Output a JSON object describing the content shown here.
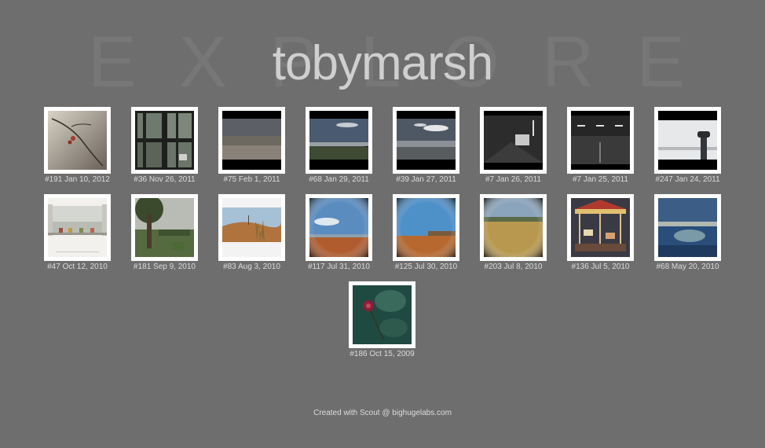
{
  "header": {
    "background_word": [
      "E",
      "X",
      "P",
      "L",
      "O",
      "R",
      "E"
    ],
    "username": "tobymarsh"
  },
  "photos": [
    {
      "caption": "#191 Jan 10, 2012",
      "icon": "bare-branch-berries-photo"
    },
    {
      "caption": "#36 Nov 26, 2011",
      "icon": "window-trees-photo"
    },
    {
      "caption": "#75 Feb 1, 2011",
      "icon": "pebble-beach-photo"
    },
    {
      "caption": "#68 Jan 29, 2011",
      "icon": "coastal-hills-photo"
    },
    {
      "caption": "#39 Jan 27, 2011",
      "icon": "seaside-clouds-photo"
    },
    {
      "caption": "#7 Jan 26, 2011",
      "icon": "car-park-tunnel-photo"
    },
    {
      "caption": "#7 Jan 25, 2011",
      "icon": "empty-car-park-photo"
    },
    {
      "caption": "#247 Jan 24, 2011",
      "icon": "coin-binoculars-photo"
    },
    {
      "caption": "#47 Oct 12, 2010",
      "icon": "windowsill-view-photo"
    },
    {
      "caption": "#181 Sep 9, 2010",
      "icon": "tree-landscape-photo"
    },
    {
      "caption": "#83 Aug 3, 2010",
      "icon": "dune-grass-photo"
    },
    {
      "caption": "#117 Jul 31, 2010",
      "icon": "sky-field-photo"
    },
    {
      "caption": "#125 Jul 30, 2010",
      "icon": "blue-sky-field-photo"
    },
    {
      "caption": "#203 Jul 8, 2010",
      "icon": "wheat-field-photo"
    },
    {
      "caption": "#136 Jul 5, 2010",
      "icon": "carousel-photo"
    },
    {
      "caption": "#68 May 20, 2010",
      "icon": "blue-water-abstract-photo"
    },
    {
      "caption": "#186 Oct 15, 2009",
      "icon": "red-flower-photo"
    }
  ],
  "footer": {
    "credit": "Created with Scout @ bighugelabs.com"
  }
}
